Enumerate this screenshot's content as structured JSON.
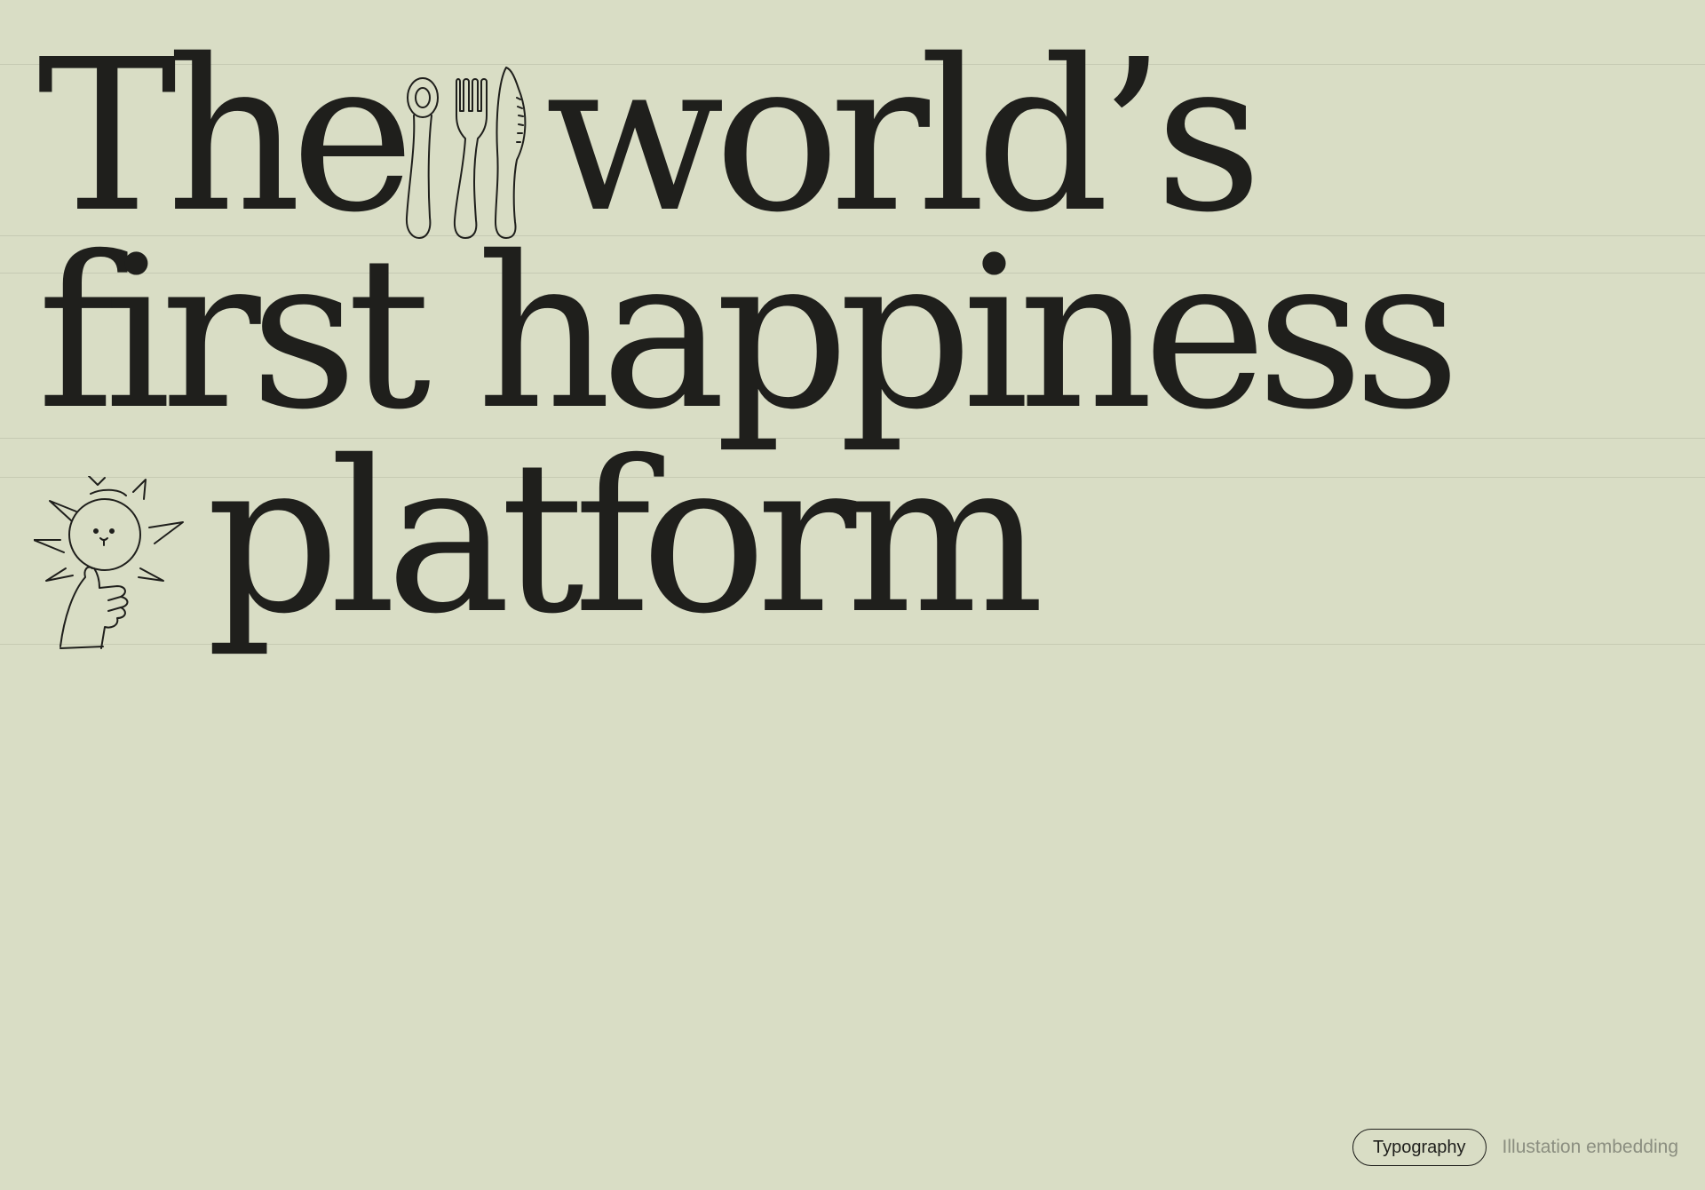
{
  "page": {
    "background_color": "#d9ddc5",
    "text_color": "#1f1f1c",
    "muted_color": "#8b8e80"
  },
  "headline": {
    "line1_word1": "The",
    "line1_word2": "world’s",
    "line2": "first happiness",
    "line3": "platform"
  },
  "illustrations": {
    "cutlery": "cutlery-icon",
    "sun_character": "sun-character-icon"
  },
  "footer": {
    "tags": [
      {
        "label": "Typography",
        "active": true
      },
      {
        "label": "Illustation embedding",
        "active": false
      }
    ]
  }
}
